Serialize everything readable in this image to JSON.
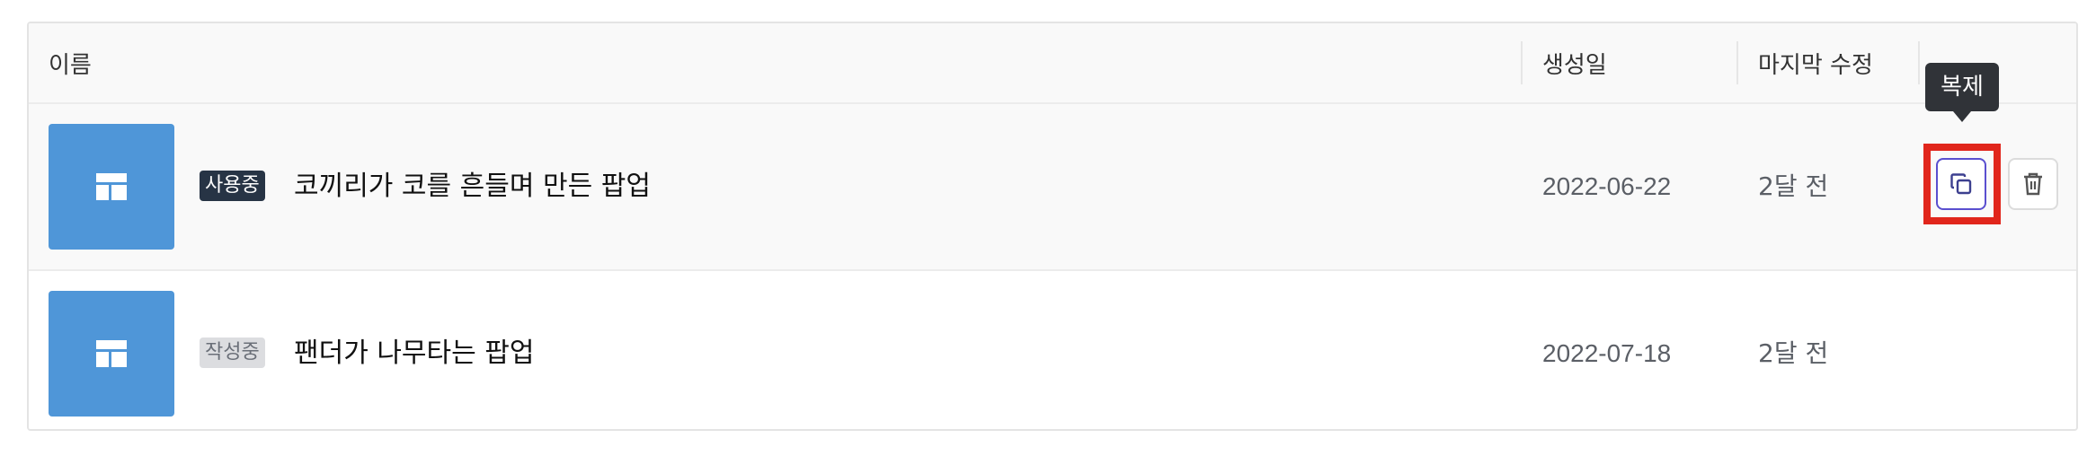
{
  "header": {
    "name": "이름",
    "created": "생성일",
    "modified": "마지막 수정"
  },
  "rows": [
    {
      "status": "사용중",
      "title": "코끼리가 코를 흔들며 만든 팝업",
      "created": "2022-06-22",
      "modified": "2달 전",
      "thumbnail_icon": "layout-icon"
    },
    {
      "status": "작성중",
      "title": "팬더가 나무타는 팝업",
      "created": "2022-07-18",
      "modified": "2달 전",
      "thumbnail_icon": "layout-icon"
    }
  ],
  "actions": {
    "tooltip": "복제",
    "copy_icon": "copy-icon",
    "delete_icon": "trash-icon"
  },
  "colors": {
    "thumbnail": "#4f96d8",
    "active_badge": "#273445",
    "draft_badge": "#dcdde0",
    "highlight": "#e1261c",
    "copy_border": "#5a4fcf"
  }
}
